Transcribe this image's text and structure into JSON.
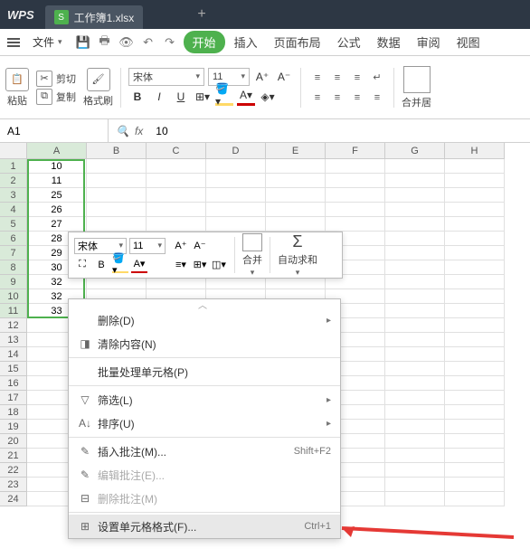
{
  "title": {
    "app": "WPS",
    "tab_name": "工作簿1.xlsx",
    "tab_icon": "S"
  },
  "menubar": {
    "file": "文件",
    "items": [
      "开始",
      "插入",
      "页面布局",
      "公式",
      "数据",
      "审阅",
      "视图"
    ]
  },
  "toolbar": {
    "paste": "粘贴",
    "cut": "剪切",
    "copy": "复制",
    "painter": "格式刷",
    "font_name": "宋体",
    "font_size": "11",
    "merge": "合并居"
  },
  "namebox": "A1",
  "fx_label": "fx",
  "fx_value": "10",
  "columns": [
    "A",
    "B",
    "C",
    "D",
    "E",
    "F",
    "G",
    "H"
  ],
  "rows_count": 24,
  "cells": {
    "A": [
      "10",
      "11",
      "25",
      "26",
      "27",
      "28",
      "29",
      "30",
      "32",
      "32",
      "33"
    ]
  },
  "minitb": {
    "font": "宋体",
    "size": "11",
    "merge": "合并",
    "autosum": "自动求和"
  },
  "context_menu": {
    "delete": "删除(D)",
    "clear": "清除内容(N)",
    "batch": "批量处理单元格(P)",
    "filter": "筛选(L)",
    "sort": "排序(U)",
    "insert_comment": "插入批注(M)...",
    "insert_comment_sc": "Shift+F2",
    "edit_comment": "编辑批注(E)...",
    "delete_comment": "删除批注(M)",
    "format_cells": "设置单元格格式(F)...",
    "format_cells_sc": "Ctrl+1"
  }
}
